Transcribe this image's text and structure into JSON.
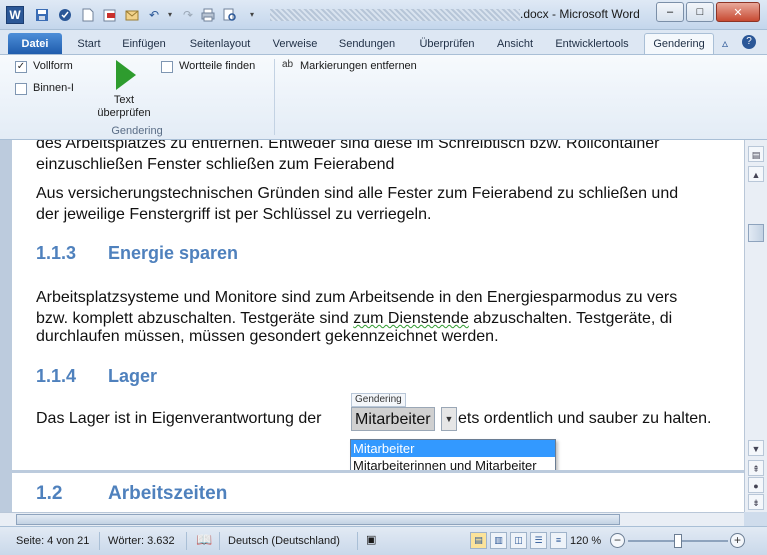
{
  "window": {
    "title_suffix": ".docx - Microsoft Word",
    "min_glyph": "–",
    "max_glyph": "□",
    "close_glyph": "✕"
  },
  "qat": {
    "word_icon_letter": "W"
  },
  "tabs": [
    {
      "label": "Datei"
    },
    {
      "label": "Start"
    },
    {
      "label": "Einfügen"
    },
    {
      "label": "Seitenlayout"
    },
    {
      "label": "Verweise"
    },
    {
      "label": "Sendungen"
    },
    {
      "label": "Überprüfen"
    },
    {
      "label": "Ansicht"
    },
    {
      "label": "Entwicklertools"
    },
    {
      "label": "Gendering"
    }
  ],
  "ribbon": {
    "vollform_label": "Vollform",
    "vollform_checked": true,
    "binnen_label": "Binnen-I",
    "binnen_checked": false,
    "text_pruefen_label_1": "Text",
    "text_pruefen_label_2": "überprüfen",
    "wortteile_label": "Wortteile finden",
    "wortteile_checked": false,
    "markierungen_label": "Markierungen entfernen",
    "abc_icon_text": "ab",
    "group_label": "Gendering"
  },
  "document": {
    "line1": "des Arbeitsplatzes zu entfernen. Entweder sind diese im Schreibtisch bzw. Rollcontainer",
    "line2": "einzuschließen Fenster schließen zum Feierabend",
    "line3": "Aus versicherungstechnischen Gründen sind alle Fester zum Feierabend zu schließen und",
    "line4": "der jeweilige Fenstergriff ist per Schlüssel zu verriegeln.",
    "h_energie_num": "1.1.3",
    "h_energie_title": "Energie sparen",
    "line5": "Arbeitsplatzsysteme und Monitore sind zum Arbeitsende in den Energiesparmodus zu vers",
    "line6_a": "bzw. komplett abzuschalten. Testgeräte sind ",
    "line6_b": "zum Dienstende",
    "line6_c": " abzuschalten. Testgeräte, di",
    "line7": "durchlaufen müssen, müssen gesondert gekennzeichnet werden.",
    "h_lager_num": "1.1.4",
    "h_lager_title": "Lager",
    "line8_a": "Das Lager ist in Eigenverantwortung der ",
    "line8_b": "ets ordentlich und sauber zu halten.",
    "h_arbeitszeiten_num": "1.2",
    "h_arbeitszeiten_title": "Arbeitszeiten"
  },
  "gendering_popup": {
    "tag": "Gendering",
    "selected_word": "Mitarbeiter",
    "suggestions": [
      {
        "label": "Mitarbeiter",
        "active": true
      },
      {
        "label": "Mitarbeiterinnen und Mitarbeiter",
        "active": false
      }
    ]
  },
  "status": {
    "page": "Seite: 4 von 21",
    "words": "Wörter: 3.632",
    "language": "Deutsch (Deutschland)",
    "zoom": "120 %",
    "zoom_minus": "−",
    "zoom_plus": "+"
  }
}
